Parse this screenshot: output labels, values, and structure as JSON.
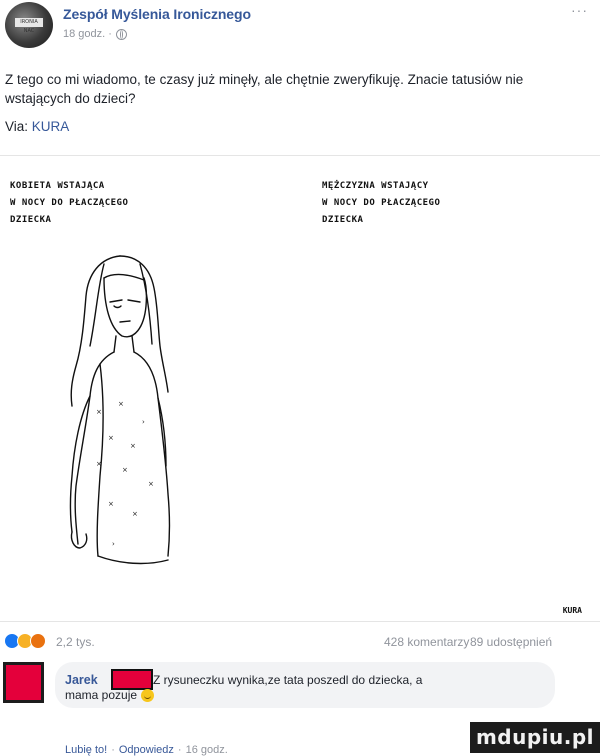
{
  "post": {
    "page_name": "Zespół Myślenia Ironicznego",
    "time": "18 godz. ·",
    "text": "Z tego co mi wiadomo, te czasy już minęły, ale chętnie zweryfikuję. Znacie tatusiów nie wstających do dzieci?",
    "via_label": "Via:",
    "via_link": "KURA",
    "more_label": "···",
    "avatar_label": "IRONIA NAC"
  },
  "comic": {
    "left_caption": "KOBIETA WSTAJĄCA\nW NOCY DO PŁACZĄCEGO\nDZIECKA",
    "right_caption": "MĘŻCZYZNA WSTAJĄCY\nW NOCY DO PŁACZĄCEGO\nDZIECKA",
    "signature": "KURA"
  },
  "reactions": {
    "count": "2,2 tys.",
    "comments": "428 komentarzy",
    "shares": "89 udostępnień"
  },
  "comment": {
    "author": "Jarek",
    "text_line1": "Z rysuneczku wynika,ze tata poszedl do dziecka, a",
    "text_line2": "mama pozuje",
    "like": "Lubię to!",
    "reply": "Odpowiedz",
    "time": "16 godz.",
    "separator": "·"
  },
  "watermark": "mdupiu.pl"
}
